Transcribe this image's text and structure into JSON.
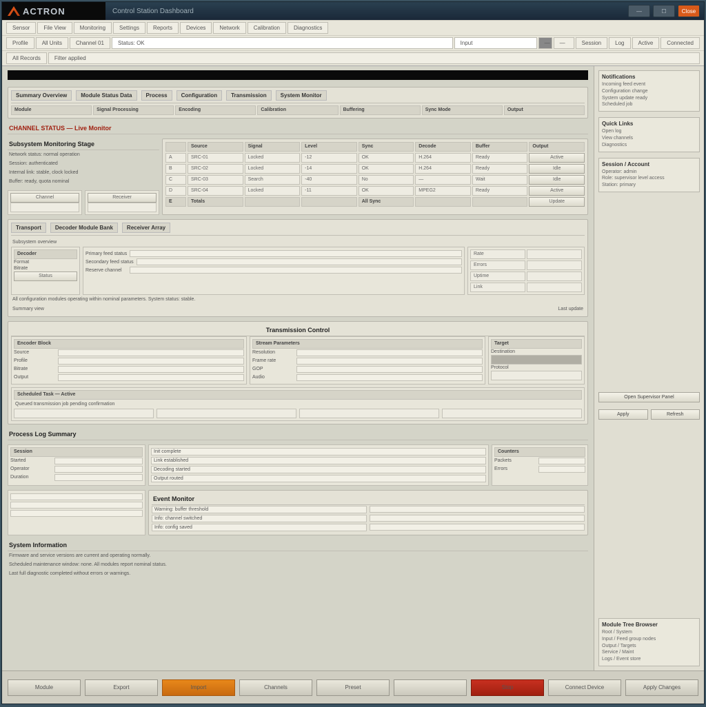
{
  "app": {
    "brand": "ACTRON",
    "title": "Control Station Dashboard"
  },
  "winbuttons": {
    "min": "—",
    "max": "☐",
    "close": "Close"
  },
  "toolbar": {
    "r1": [
      "Sensor",
      "File View",
      "Monitoring",
      "Settings",
      "Reports",
      "Devices",
      "Network",
      "Calibration",
      "Diagnostics"
    ],
    "r2": [
      "Profile",
      "All Units",
      "Channel 01",
      "Status: OK",
      "Input",
      "—",
      "—",
      "Session",
      "Log",
      "Active",
      "Connected"
    ],
    "r3": [
      "All Records",
      "Filter applied"
    ]
  },
  "panel1": {
    "tabs": [
      "Summary Overview",
      "Module Status Data",
      "Process",
      "Configuration",
      "Transmission",
      "System Monitor"
    ],
    "cols": [
      "Module",
      "Signal Processing",
      "Encoding",
      "Calibration",
      "Buffering",
      "Sync Mode",
      "Output"
    ]
  },
  "section2": {
    "title": "CHANNEL STATUS — Live Monitor",
    "subtitle": "Subsystem Monitoring Stage",
    "lines": [
      "Network status: normal operation",
      "Session: authenticated",
      "Internal link: stable, clock locked",
      "Buffer: ready, quota nominal"
    ],
    "minis": [
      "Channel",
      "Receiver"
    ],
    "grid_cols": [
      "",
      "Source",
      "Signal",
      "Level",
      "Sync",
      "Decode",
      "Buffer",
      "Output"
    ],
    "grid_rows": [
      [
        "A",
        "SRC-01",
        "Locked",
        "-12",
        "OK",
        "H.264",
        "Ready",
        "Active"
      ],
      [
        "B",
        "SRC-02",
        "Locked",
        "-14",
        "OK",
        "H.264",
        "Ready",
        "Idle"
      ],
      [
        "C",
        "SRC-03",
        "Search",
        "-40",
        "No",
        "—",
        "Wait",
        "Idle"
      ],
      [
        "D",
        "SRC-04",
        "Locked",
        "-11",
        "OK",
        "MPEG2",
        "Ready",
        "Active"
      ],
      [
        "E",
        "Totals",
        "",
        "",
        "All Sync",
        "",
        "",
        "Update"
      ]
    ]
  },
  "section3": {
    "tabs": [
      "Transport",
      "Decoder Module Bank",
      "Receiver Array"
    ],
    "sub": "Subsystem overview",
    "box1": {
      "hdr": "Decoder",
      "fields": [
        "Format",
        "Bitrate",
        "Status"
      ]
    },
    "box2": {
      "rows": [
        "Primary feed status",
        "Secondary feed status",
        "Reserve channel"
      ]
    },
    "box3": {
      "rows": [
        "Rate",
        "Errors",
        "Uptime",
        "Link"
      ]
    },
    "note": "All configuration modules operating within nominal parameters. System status: stable.",
    "foot": [
      "Summary view",
      "Last update"
    ]
  },
  "section4": {
    "title": "Transmission Control",
    "left": {
      "hdr": "Encoder Block",
      "fields": [
        "Source",
        "Profile",
        "Bitrate",
        "Output"
      ]
    },
    "mid": {
      "hdr": "Stream Parameters",
      "fields": [
        "Resolution",
        "Frame rate",
        "GOP",
        "Audio"
      ]
    },
    "right": {
      "hdr": "Target",
      "fields": [
        "Destination",
        "Protocol"
      ]
    },
    "lower": {
      "hdr": "Scheduled Task — Active",
      "line": "Queued transmission job pending confirmation"
    }
  },
  "section5": {
    "title": "Process Log Summary",
    "left": {
      "hdr": "Session",
      "fields": [
        "Started",
        "Operator",
        "Duration"
      ]
    },
    "mid": {
      "rows": [
        "Init complete",
        "Link established",
        "Decoding started",
        "Output routed"
      ]
    },
    "right": {
      "hdr": "Counters",
      "fields": [
        "Packets",
        "Errors"
      ]
    }
  },
  "section6": {
    "title": "Event Monitor",
    "rows": [
      "Warning: buffer threshold",
      "Info: channel switched",
      "Info: config saved"
    ]
  },
  "bottom_note": {
    "hdr": "System Information",
    "lines": [
      "Firmware and service versions are current and operating normally.",
      "Scheduled maintenance window: none. All modules report nominal status.",
      "Last full diagnostic completed without errors or warnings."
    ]
  },
  "sidebar": {
    "box1": {
      "hdr": "Notifications",
      "lines": [
        "Incoming feed event",
        "Configuration change",
        "System update ready",
        "Scheduled job"
      ]
    },
    "box2": {
      "hdr": "Quick Links",
      "lines": [
        "Open log",
        "View channels",
        "Diagnostics"
      ]
    },
    "box3": {
      "hdr": "Session / Account",
      "lines": [
        "Operator: admin",
        "Role: supervisor level access",
        "Station: primary"
      ]
    },
    "action": "Open Supervisor Panel",
    "btns": [
      "Apply",
      "Refresh"
    ],
    "box4": {
      "hdr": "Module Tree Browser",
      "lines": [
        "Root / System",
        "Input / Feed group nodes",
        "Output / Targets",
        "Service / Maint",
        "Logs / Event store"
      ]
    }
  },
  "footer": {
    "b1": "Module",
    "b2": "Export",
    "b3": "Import",
    "b4": "Channels",
    "b5": "Preset",
    "b6": "",
    "b7": "Stop",
    "b8": "Connect Device",
    "b9": "Apply Changes"
  }
}
